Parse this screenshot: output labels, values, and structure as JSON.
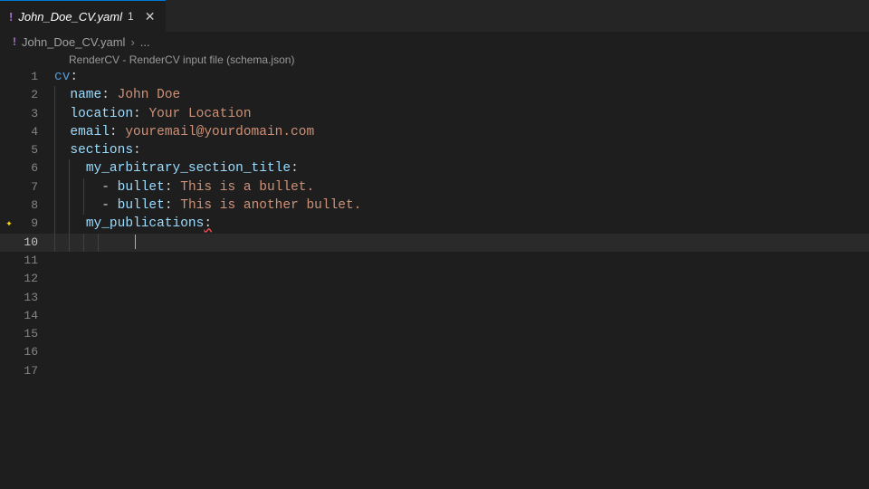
{
  "tab": {
    "filename": "John_Doe_CV.yaml",
    "modified_indicator": "1"
  },
  "breadcrumb": {
    "filename": "John_Doe_CV.yaml",
    "separator": "›",
    "more": "..."
  },
  "codelens": {
    "text": "RenderCV - RenderCV input file (schema.json)"
  },
  "code": {
    "lines": {
      "1": {
        "num": "1",
        "k1": "cv",
        "colon": ":"
      },
      "2": {
        "num": "2",
        "k1": "name",
        "colon": ": ",
        "v": "John Doe"
      },
      "3": {
        "num": "3",
        "k1": "location",
        "colon": ": ",
        "v": "Your Location"
      },
      "4": {
        "num": "4",
        "k1": "email",
        "colon": ": ",
        "v": "youremail@yourdomain.com"
      },
      "5": {
        "num": "5",
        "k1": "sections",
        "colon": ":"
      },
      "6": {
        "num": "6",
        "k1": "my_arbitrary_section_title",
        "colon": ":"
      },
      "7": {
        "num": "7",
        "dash": "- ",
        "k1": "bullet",
        "colon": ": ",
        "v": "This is a bullet."
      },
      "8": {
        "num": "8",
        "dash": "- ",
        "k1": "bullet",
        "colon": ": ",
        "v": "This is another bullet."
      },
      "9": {
        "num": "9",
        "k1": "my_publications",
        "colon": ":"
      },
      "10": {
        "num": "10"
      },
      "11": {
        "num": "11"
      },
      "12": {
        "num": "12"
      },
      "13": {
        "num": "13"
      },
      "14": {
        "num": "14"
      },
      "15": {
        "num": "15"
      },
      "16": {
        "num": "16"
      },
      "17": {
        "num": "17"
      }
    }
  }
}
